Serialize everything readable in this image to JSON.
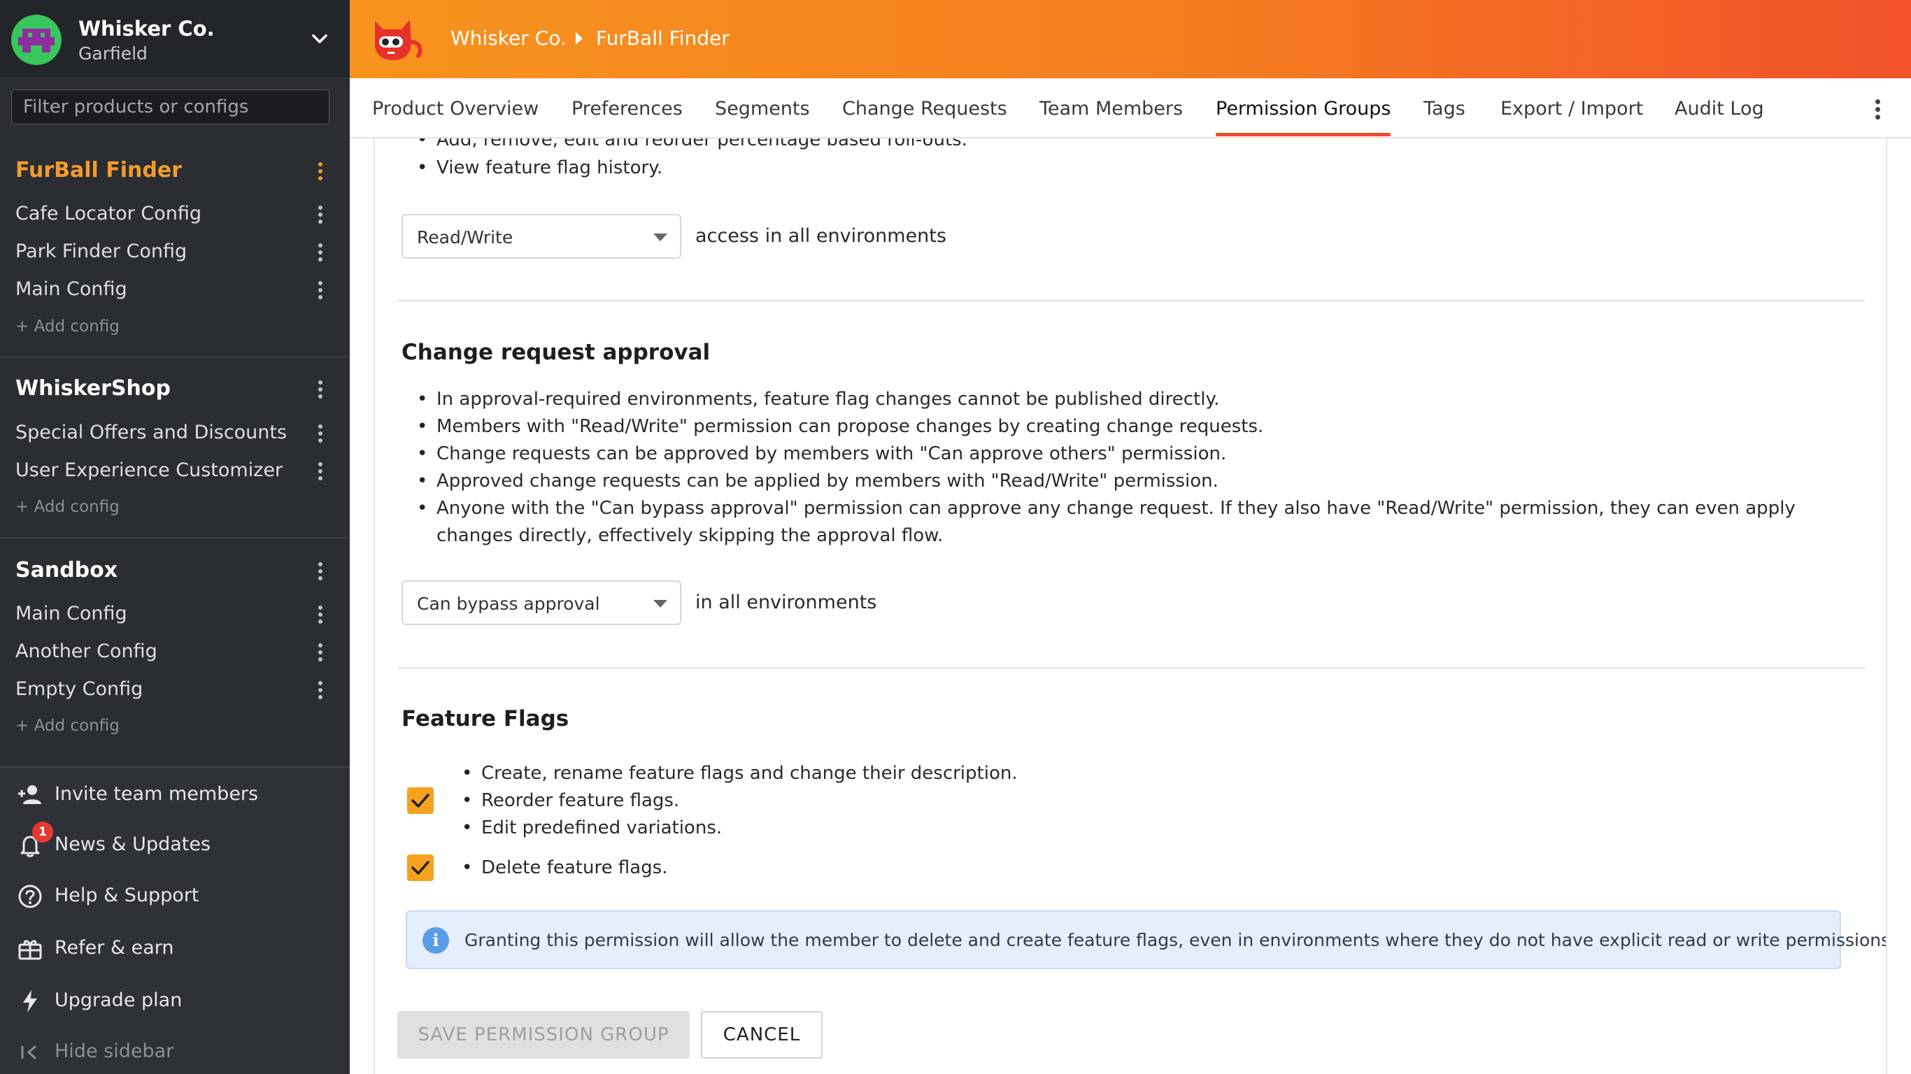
{
  "org": {
    "name": "Whisker Co.",
    "user": "Garfield"
  },
  "sidebar": {
    "filter_placeholder": "Filter products or configs",
    "products": [
      {
        "name": "FurBall Finder",
        "configs": [
          "Cafe Locator Config",
          "Park Finder Config",
          "Main Config"
        ],
        "add_label": "+ Add config"
      },
      {
        "name": "WhiskerShop",
        "configs": [
          "Special Offers and Discounts",
          "User Experience Customizer"
        ],
        "add_label": "+ Add config"
      },
      {
        "name": "Sandbox",
        "configs": [
          "Main Config",
          "Another Config",
          "Empty Config"
        ],
        "add_label": "+ Add config"
      }
    ],
    "bottom": {
      "invite": "Invite team members",
      "news": "News & Updates",
      "news_badge": "1",
      "help": "Help & Support",
      "refer": "Refer & earn",
      "upgrade": "Upgrade plan",
      "hide": "Hide sidebar"
    }
  },
  "header": {
    "crumb_org": "Whisker Co.",
    "crumb_product": "FurBall Finder"
  },
  "tabs": [
    "Product Overview",
    "Preferences",
    "Segments",
    "Change Requests",
    "Team Members",
    "Permission Groups",
    "Tags",
    "Export / Import",
    "Audit Log"
  ],
  "active_tab": "Permission Groups",
  "content": {
    "top_bullets": [
      "Add, remove, edit and reorder percentage based roll-outs.",
      "View feature flag history."
    ],
    "access_select": "Read/Write",
    "access_suffix": "access in all environments",
    "approval": {
      "title": "Change request approval",
      "bullets": [
        "In approval-required environments, feature flag changes cannot be published directly.",
        "Members with \"Read/Write\" permission can propose changes by creating change requests.",
        "Change requests can be approved by members with \"Can approve others\" permission.",
        "Approved change requests can be applied by members with \"Read/Write\" permission.",
        "Anyone with the \"Can bypass approval\" permission can approve any change request. If they also have \"Read/Write\" permission, they can even apply",
        "changes directly, effectively skipping the approval flow."
      ],
      "select": "Can bypass approval",
      "suffix": "in all environments"
    },
    "flags": {
      "title": "Feature Flags",
      "group1": [
        "Create, rename feature flags and change their description.",
        "Reorder feature flags.",
        "Edit predefined variations."
      ],
      "group1_checked": true,
      "group2": [
        "Delete feature flags."
      ],
      "group2_checked": true,
      "info": "Granting this permission will allow the member to delete and create feature flags, even in environments where they do not have explicit read or write permissions."
    },
    "save_label": "SAVE PERMISSION GROUP",
    "cancel_label": "CANCEL"
  },
  "colors": {
    "accent": "#f49b2e",
    "tab_underline": "#e94e2a",
    "checkbox": "#f7a21f"
  }
}
